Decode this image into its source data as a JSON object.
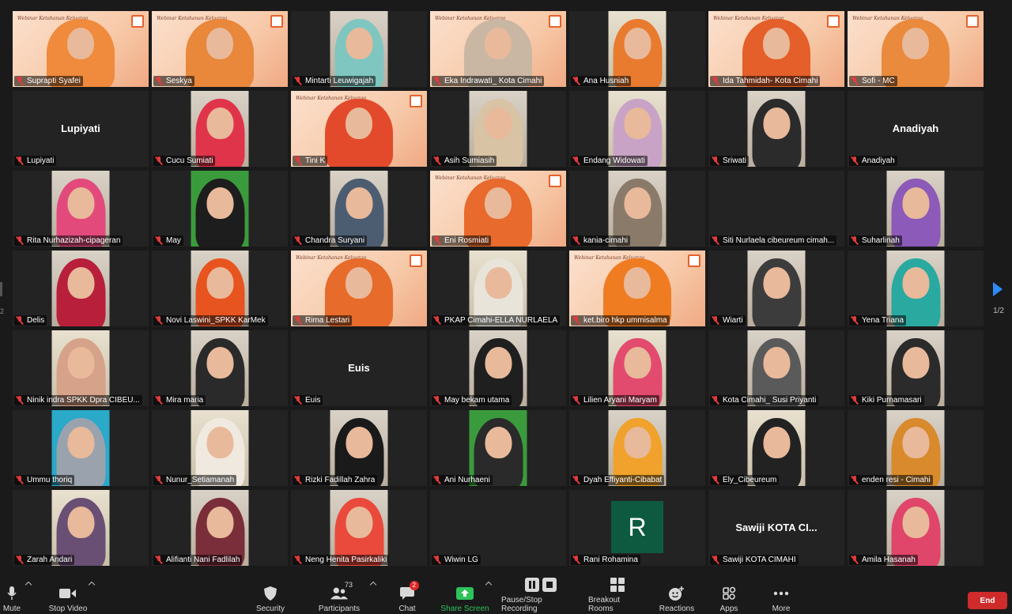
{
  "participants": [
    {
      "name": "Suprapti Syafei",
      "kind": "slide",
      "hijab": "#f08a3c"
    },
    {
      "name": "Seskya",
      "kind": "slide",
      "hijab": "#e9873b",
      "active": true
    },
    {
      "name": "Mintarti Leuwigajah",
      "kind": "room",
      "hijab": "#7fc6c0"
    },
    {
      "name": "Eka Indrawati_ Kota Cimahi",
      "kind": "slide",
      "hijab": "#c9b7a4"
    },
    {
      "name": "Ana Husniah",
      "kind": "wall",
      "hijab": "#e97b2f"
    },
    {
      "name": "Ida Tahmidah- Kota Cimahi",
      "kind": "slide",
      "hijab": "#e45f29"
    },
    {
      "name": "Sofi - MC",
      "kind": "slide",
      "hijab": "#e98a3d"
    },
    {
      "name": "Lupiyati",
      "kind": "text",
      "center": "Lupiyati"
    },
    {
      "name": "Cucu Sumiati",
      "kind": "room",
      "hijab": "#e0344a"
    },
    {
      "name": "Tini K",
      "kind": "slide",
      "hijab": "#e34a2c"
    },
    {
      "name": "Asih Sumiasih",
      "kind": "room",
      "hijab": "#d8c3a5"
    },
    {
      "name": "Endang Widowati",
      "kind": "wall",
      "hijab": "#c9a3c5"
    },
    {
      "name": "Sriwati",
      "kind": "room",
      "hijab": "#2b2b2b"
    },
    {
      "name": "Anadiyah",
      "kind": "text",
      "center": "Anadiyah"
    },
    {
      "name": "Rita Nurhazizah-cipageran",
      "kind": "room",
      "hijab": "#e24a7c"
    },
    {
      "name": "May",
      "kind": "green",
      "hijab": "#1d1d1d"
    },
    {
      "name": "Chandra Suryani",
      "kind": "room",
      "hijab": "#4c5d72"
    },
    {
      "name": "Eni Rosmiati",
      "kind": "slide",
      "hijab": "#e86a2c"
    },
    {
      "name": "kania-cimahi",
      "kind": "room",
      "hijab": "#8a7a6a"
    },
    {
      "name": "Siti Nurlaela cibeureum cimah...",
      "kind": "empty"
    },
    {
      "name": "Suharlinah",
      "kind": "room",
      "hijab": "#8c5ab8"
    },
    {
      "name": "Delis",
      "kind": "room",
      "hijab": "#b81f3a"
    },
    {
      "name": "Novi Laswini_SPKK KarMek",
      "kind": "room",
      "hijab": "#e8541f"
    },
    {
      "name": "Rima Lestari",
      "kind": "slide",
      "hijab": "#e76b2a"
    },
    {
      "name": "PKAP Cimahi-ELLA NURLAELA",
      "kind": "wall",
      "hijab": "#e9e4da"
    },
    {
      "name": "ket.biro hkp ummisalma",
      "kind": "slide",
      "hijab": "#f07c22"
    },
    {
      "name": "Wiarti",
      "kind": "room",
      "hijab": "#3c3c3c"
    },
    {
      "name": "Yena Triana",
      "kind": "room",
      "hijab": "#2aa9a0"
    },
    {
      "name": "Ninik indra SPKK Dpra CIBEU...",
      "kind": "wall",
      "hijab": "#d7a28a"
    },
    {
      "name": "Mira maria",
      "kind": "room",
      "hijab": "#2a2a2a"
    },
    {
      "name": "Euis",
      "kind": "text",
      "center": "Euis"
    },
    {
      "name": "May  bekam utama",
      "kind": "room",
      "hijab": "#1f1f1f"
    },
    {
      "name": "Lilien Aryani Maryam",
      "kind": "wall",
      "hijab": "#e24b6e"
    },
    {
      "name": "Kota Cimahi_ Susi Priyanti",
      "kind": "room",
      "hijab": "#5a5a5a"
    },
    {
      "name": "Kiki Purnamasari",
      "kind": "room",
      "hijab": "#2b2b2b"
    },
    {
      "name": "Ummu thoriq",
      "kind": "teal",
      "hijab": "#9aa3ad"
    },
    {
      "name": "Nunur_Setiamanah",
      "kind": "wall",
      "hijab": "#f0e9df"
    },
    {
      "name": "Rizki Fadillah Zahra",
      "kind": "room",
      "hijab": "#1a1a1a"
    },
    {
      "name": "Ani Nurhaeni",
      "kind": "green",
      "hijab": "#2a2a2a"
    },
    {
      "name": "Dyah Effiyanti-Cibabat",
      "kind": "room",
      "hijab": "#f0a22c"
    },
    {
      "name": "Ely_Cibeureum",
      "kind": "wall",
      "hijab": "#222222"
    },
    {
      "name": "enden resi - Cimahi",
      "kind": "room",
      "hijab": "#d98a2c"
    },
    {
      "name": "Zarah Andari",
      "kind": "wall",
      "hijab": "#6a4f75"
    },
    {
      "name": "Alifianti Nani Fadlilah",
      "kind": "room",
      "hijab": "#7a2e3a"
    },
    {
      "name": "Neng Henita Pasirkaliki",
      "kind": "room",
      "hijab": "#e94a3c"
    },
    {
      "name": "Wiwin LG",
      "kind": "empty"
    },
    {
      "name": "Rani Rohamina",
      "kind": "avatar",
      "initial": "R"
    },
    {
      "name": "Sawiji KOTA CIMAHI",
      "kind": "text",
      "center": "Sawiji KOTA CI..."
    },
    {
      "name": "Amila Hasanah",
      "kind": "room",
      "hijab": "#e0456a"
    }
  ],
  "slide_text": "Webinar Ketahanan Keluarga",
  "page": {
    "current": "1/2",
    "left": "2"
  },
  "toolbar": {
    "mute": "Mute",
    "stop_video": "Stop Video",
    "security": "Security",
    "participants": "Participants",
    "participants_count": "73",
    "chat": "Chat",
    "chat_badge": "2",
    "share_screen": "Share Screen",
    "recording": "Pause/Stop Recording",
    "breakout": "Breakout Rooms",
    "reactions": "Reactions",
    "apps": "Apps",
    "more": "More",
    "end": "End"
  },
  "colors": {
    "accent": "#2d8cff",
    "end": "#cf2b2b",
    "share": "#2fc25b",
    "active_border": "#e5e54a",
    "avatar_bg": "#0e5a41"
  }
}
